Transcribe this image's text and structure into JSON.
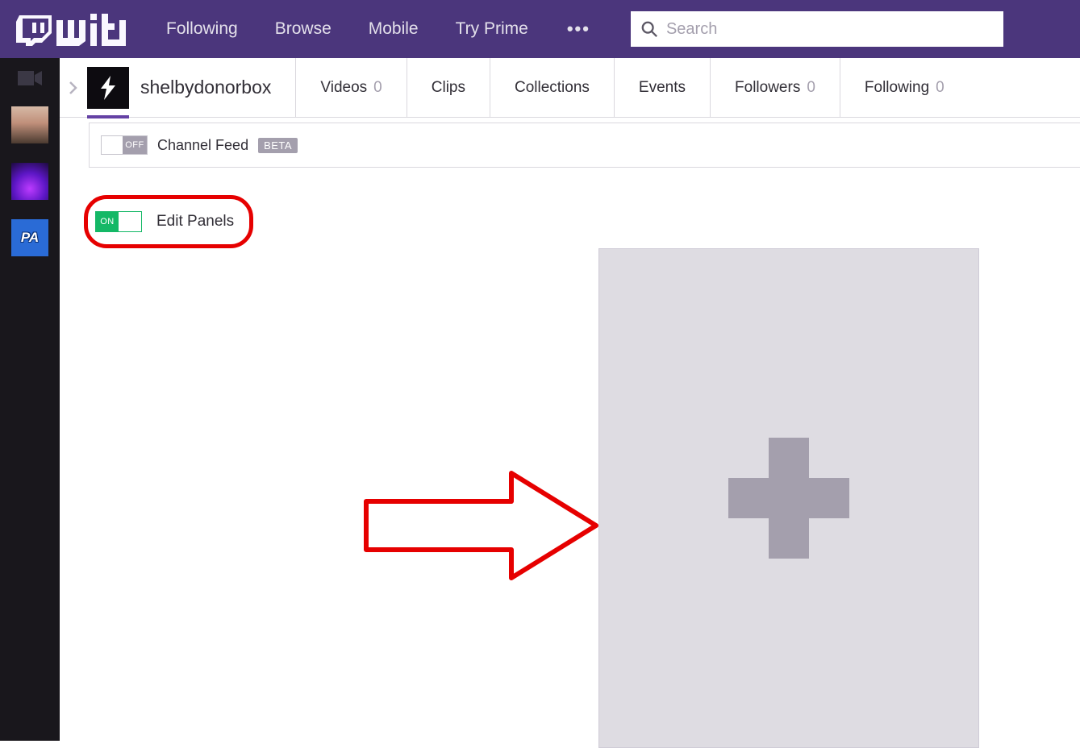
{
  "nav": {
    "links": [
      "Following",
      "Browse",
      "Mobile",
      "Try Prime"
    ],
    "more_glyph": "•••",
    "search_placeholder": "Search"
  },
  "sidebar": {
    "badge_text": "PA"
  },
  "channel": {
    "username": "shelbydonorbox",
    "tabs": {
      "videos": {
        "label": "Videos",
        "count": "0"
      },
      "clips": {
        "label": "Clips"
      },
      "collections": {
        "label": "Collections"
      },
      "events": {
        "label": "Events"
      },
      "followers": {
        "label": "Followers",
        "count": "0"
      },
      "following": {
        "label": "Following",
        "count": "0"
      }
    }
  },
  "feed": {
    "toggle_label": "OFF",
    "label": "Channel Feed",
    "badge": "BETA"
  },
  "edit_panels": {
    "toggle_label": "ON",
    "label": "Edit Panels"
  }
}
